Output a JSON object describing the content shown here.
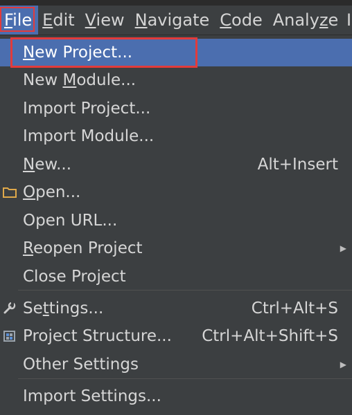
{
  "menubar": {
    "items": [
      {
        "pre": "",
        "m": "F",
        "post": "ile"
      },
      {
        "pre": "",
        "m": "E",
        "post": "dit"
      },
      {
        "pre": "",
        "m": "V",
        "post": "iew"
      },
      {
        "pre": "",
        "m": "N",
        "post": "avigate"
      },
      {
        "pre": "",
        "m": "C",
        "post": "ode"
      },
      {
        "pre": "Analy",
        "m": "z",
        "post": "e"
      }
    ],
    "cutoff_glyph": "I"
  },
  "colors": {
    "menu_background": "#3c3f41",
    "selection": "#4b6eaf",
    "highlight_box": "#e23b3b",
    "text": "#d6d6d6"
  },
  "file_menu": {
    "items": [
      {
        "pre": "",
        "m": "N",
        "post": "ew Project...",
        "shortcut": "",
        "submenu": false,
        "icon": ""
      },
      {
        "pre": "New ",
        "m": "M",
        "post": "odule...",
        "shortcut": "",
        "submenu": false,
        "icon": ""
      },
      {
        "pre": "Import Project...",
        "m": "",
        "post": "",
        "shortcut": "",
        "submenu": false,
        "icon": ""
      },
      {
        "pre": "Import Module...",
        "m": "",
        "post": "",
        "shortcut": "",
        "submenu": false,
        "icon": ""
      },
      {
        "pre": "",
        "m": "N",
        "post": "ew...",
        "shortcut": "Alt+Insert",
        "submenu": false,
        "icon": ""
      },
      {
        "pre": "",
        "m": "O",
        "post": "pen...",
        "shortcut": "",
        "submenu": false,
        "icon": "folder-icon"
      },
      {
        "pre": "Open URL...",
        "m": "",
        "post": "",
        "shortcut": "",
        "submenu": false,
        "icon": ""
      },
      {
        "pre": "",
        "m": "R",
        "post": "eopen Project",
        "shortcut": "",
        "submenu": true,
        "icon": ""
      },
      {
        "pre": "Close Project",
        "m": "",
        "post": "",
        "shortcut": "",
        "submenu": false,
        "icon": ""
      },
      {
        "pre": "Se",
        "m": "t",
        "post": "tings...",
        "shortcut": "Ctrl+Alt+S",
        "submenu": false,
        "icon": "wrench-icon"
      },
      {
        "pre": "Project Structure...",
        "m": "",
        "post": "",
        "shortcut": "Ctrl+Alt+Shift+S",
        "submenu": false,
        "icon": "project-structure-icon"
      },
      {
        "pre": "Other Settings",
        "m": "",
        "post": "",
        "shortcut": "",
        "submenu": true,
        "icon": ""
      },
      {
        "pre": "Import Settings...",
        "m": "",
        "post": "",
        "shortcut": "",
        "submenu": false,
        "icon": ""
      }
    ]
  }
}
